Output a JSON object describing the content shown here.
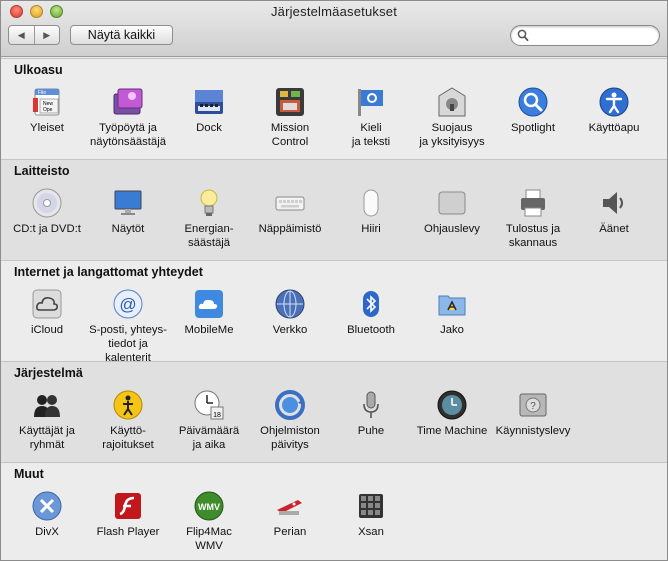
{
  "window": {
    "title": "Järjestelmäasetukset"
  },
  "toolbar": {
    "back_label": "◀",
    "forward_label": "▶",
    "show_all_label": "Näytä kaikki",
    "search": {
      "value": "",
      "placeholder": ""
    }
  },
  "sections": [
    {
      "heading": "Ulkoasu",
      "items": [
        {
          "label": "Yleiset",
          "icon": "general-icon"
        },
        {
          "label": "Työpöytä ja\nnäytönsäästäjä",
          "icon": "desktop-screensaver-icon"
        },
        {
          "label": "Dock",
          "icon": "dock-icon"
        },
        {
          "label": "Mission\nControl",
          "icon": "mission-control-icon"
        },
        {
          "label": "Kieli\nja teksti",
          "icon": "language-text-icon"
        },
        {
          "label": "Suojaus\nja yksityisyys",
          "icon": "security-privacy-icon"
        },
        {
          "label": "Spotlight",
          "icon": "spotlight-icon"
        },
        {
          "label": "Käyttöapu",
          "icon": "accessibility-icon"
        }
      ]
    },
    {
      "heading": "Laitteisto",
      "items": [
        {
          "label": "CD:t ja DVD:t",
          "icon": "cd-dvd-icon"
        },
        {
          "label": "Näytöt",
          "icon": "displays-icon"
        },
        {
          "label": "Energian-\nsäästäjä",
          "icon": "energy-saver-icon"
        },
        {
          "label": "Näppäimistö",
          "icon": "keyboard-icon"
        },
        {
          "label": "Hiiri",
          "icon": "mouse-icon"
        },
        {
          "label": "Ohjauslevy",
          "icon": "trackpad-icon"
        },
        {
          "label": "Tulostus ja\nskannaus",
          "icon": "print-scan-icon"
        },
        {
          "label": "Äänet",
          "icon": "sound-icon"
        }
      ]
    },
    {
      "heading": "Internet ja langattomat yhteydet",
      "items": [
        {
          "label": "iCloud",
          "icon": "icloud-icon"
        },
        {
          "label": "S-posti, yhteys-\ntiedot ja kalenterit",
          "icon": "mail-contacts-calendars-icon"
        },
        {
          "label": "MobileMe",
          "icon": "mobileme-icon"
        },
        {
          "label": "Verkko",
          "icon": "network-icon"
        },
        {
          "label": "Bluetooth",
          "icon": "bluetooth-icon"
        },
        {
          "label": "Jako",
          "icon": "sharing-icon"
        }
      ]
    },
    {
      "heading": "Järjestelmä",
      "items": [
        {
          "label": "Käyttäjät ja\nryhmät",
          "icon": "users-groups-icon"
        },
        {
          "label": "Käyttö-\nrajoitukset",
          "icon": "parental-controls-icon"
        },
        {
          "label": "Päivämäärä\nja aika",
          "icon": "date-time-icon"
        },
        {
          "label": "Ohjelmiston\npäivitys",
          "icon": "software-update-icon"
        },
        {
          "label": "Puhe",
          "icon": "speech-icon"
        },
        {
          "label": "Time Machine",
          "icon": "time-machine-icon"
        },
        {
          "label": "Käynnistyslevy",
          "icon": "startup-disk-icon"
        }
      ]
    },
    {
      "heading": "Muut",
      "items": [
        {
          "label": "DivX",
          "icon": "divx-icon"
        },
        {
          "label": "Flash Player",
          "icon": "flash-player-icon"
        },
        {
          "label": "Flip4Mac\nWMV",
          "icon": "flip4mac-icon"
        },
        {
          "label": "Perian",
          "icon": "perian-icon"
        },
        {
          "label": "Xsan",
          "icon": "xsan-icon"
        }
      ]
    }
  ]
}
